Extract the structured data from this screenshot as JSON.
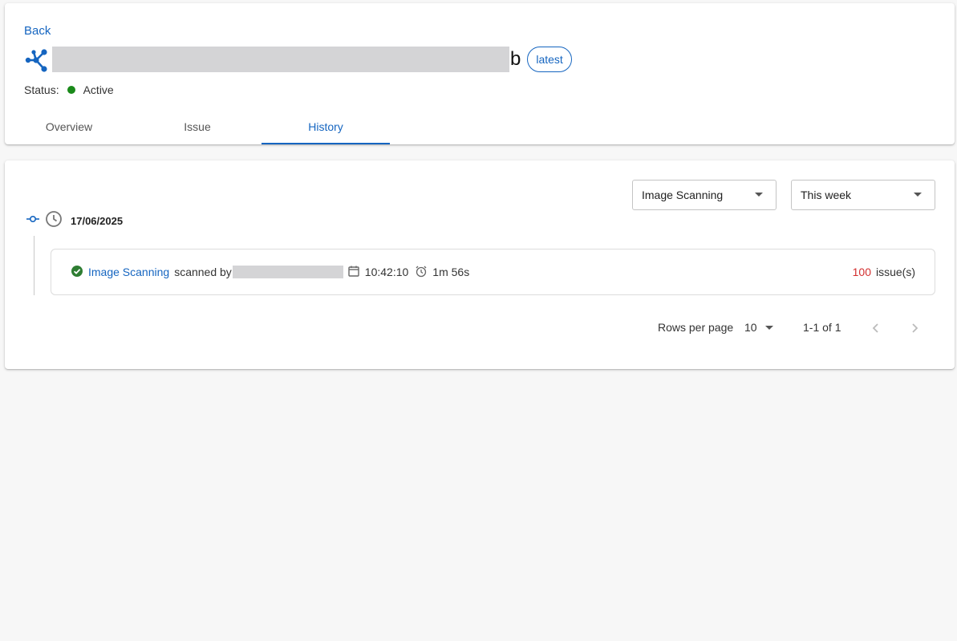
{
  "header": {
    "back_label": "Back",
    "name_suffix": "b",
    "tag_label": "latest",
    "status_label": "Status:",
    "status_value": "Active",
    "status_color": "#1a8a1a"
  },
  "tabs": [
    {
      "label": "Overview",
      "active": false
    },
    {
      "label": "Issue",
      "active": false
    },
    {
      "label": "History",
      "active": true
    }
  ],
  "filters": {
    "scan_type": "Image Scanning",
    "period": "This week"
  },
  "history": {
    "date": "17/06/2025",
    "entries": [
      {
        "scan_name": "Image Scanning",
        "scanned_by_label": "scanned by",
        "time": "10:42:10",
        "duration": "1m 56s",
        "issue_count": "100",
        "issue_label": "issue(s)",
        "status": "success"
      }
    ]
  },
  "pagination": {
    "rows_per_page_label": "Rows per page",
    "rows_per_page": "10",
    "range": "1-1 of 1"
  },
  "icons": [
    "network-icon",
    "dropdown-caret-icon",
    "commit-icon",
    "clock-icon",
    "check-circle-icon",
    "calendar-icon",
    "alarm-icon",
    "chevron-left-icon",
    "chevron-right-icon"
  ],
  "colors": {
    "accent": "#1565c0",
    "issue": "#d32f2f",
    "success": "#2e7d32"
  }
}
